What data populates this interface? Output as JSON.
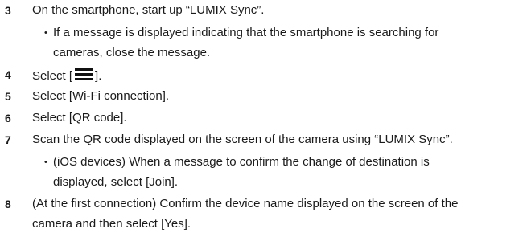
{
  "steps": [
    {
      "num": "3",
      "text": "On the smartphone, start up “LUMIX Sync”.",
      "bullet": {
        "line1": "If a message is displayed indicating that the smartphone is searching for",
        "line2": "cameras, close the message."
      }
    },
    {
      "num": "4",
      "text_before": "Select [",
      "icon": "menu-icon",
      "text_after": "]."
    },
    {
      "num": "5",
      "text": "Select [Wi-Fi connection]."
    },
    {
      "num": "6",
      "text": "Select [QR code]."
    },
    {
      "num": "7",
      "text": "Scan the QR code displayed on the screen of the camera using “LUMIX Sync”.",
      "bullet": {
        "line1": "(iOS devices) When a message to confirm the change of destination is",
        "line2": "displayed, select [Join]."
      }
    },
    {
      "num": "8",
      "line1": "(At the first connection) Confirm the device name displayed on the screen of the",
      "line2": "camera and then select [Yes]."
    }
  ],
  "bullet_glyph": "•"
}
